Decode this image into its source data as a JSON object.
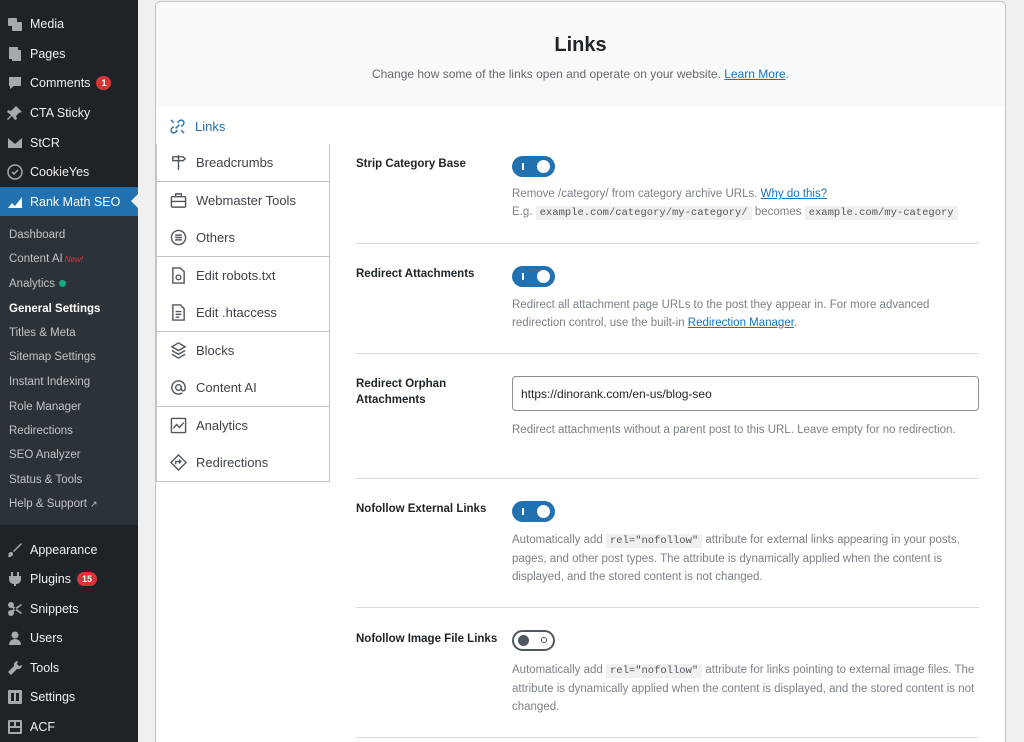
{
  "sidebar": {
    "top_items": [
      {
        "label": "Media",
        "icon": "media-icon"
      },
      {
        "label": "Pages",
        "icon": "pages-icon"
      },
      {
        "label": "Comments",
        "icon": "comments-icon",
        "badge": "1"
      },
      {
        "label": "CTA Sticky",
        "icon": "pin-icon"
      },
      {
        "label": "StCR",
        "icon": "envelope-icon"
      },
      {
        "label": "CookieYes",
        "icon": "cookie-icon"
      },
      {
        "label": "Rank Math SEO",
        "icon": "rank-math-icon"
      }
    ],
    "submenu": [
      {
        "label": "Dashboard"
      },
      {
        "label": "Content AI",
        "tag": "New!"
      },
      {
        "label": "Analytics"
      },
      {
        "label": "General Settings"
      },
      {
        "label": "Titles & Meta"
      },
      {
        "label": "Sitemap Settings"
      },
      {
        "label": "Instant Indexing"
      },
      {
        "label": "Role Manager"
      },
      {
        "label": "Redirections"
      },
      {
        "label": "SEO Analyzer"
      },
      {
        "label": "Status & Tools"
      },
      {
        "label": "Help & Support"
      }
    ],
    "bottom_items": [
      {
        "label": "Appearance",
        "icon": "brush-icon"
      },
      {
        "label": "Plugins",
        "icon": "plugin-icon",
        "badge": "15"
      },
      {
        "label": "Snippets",
        "icon": "snippets-icon"
      },
      {
        "label": "Users",
        "icon": "users-icon"
      },
      {
        "label": "Tools",
        "icon": "wrench-icon"
      },
      {
        "label": "Settings",
        "icon": "settings-icon"
      },
      {
        "label": "ACF",
        "icon": "acf-icon"
      }
    ]
  },
  "header": {
    "title": "Links",
    "description": "Change how some of the links open and operate on your website.",
    "learn_more": "Learn More",
    "period": "."
  },
  "tabs": [
    {
      "label": "Links",
      "icon": "links-icon",
      "active": true
    },
    {
      "label": "Breadcrumbs",
      "icon": "signpost-icon"
    },
    {
      "label": "Webmaster Tools",
      "icon": "toolbox-icon"
    },
    {
      "label": "Others",
      "icon": "list-circle-icon"
    },
    {
      "label": "Edit robots.txt",
      "icon": "file-robot-icon"
    },
    {
      "label": "Edit .htaccess",
      "icon": "file-text-icon"
    },
    {
      "label": "Blocks",
      "icon": "blocks-icon"
    },
    {
      "label": "Content AI",
      "icon": "at-icon"
    },
    {
      "label": "Analytics",
      "icon": "analytics-icon"
    },
    {
      "label": "Redirections",
      "icon": "redirect-icon"
    }
  ],
  "settings": {
    "strip_category": {
      "label": "Strip Category Base",
      "enabled": true,
      "desc_1": "Remove /category/ from category archive URLs.",
      "why_link": "Why do this?",
      "eg": "E.g.",
      "code_from": "example.com/category/my-category/",
      "becomes": "becomes",
      "code_to": "example.com/my-category"
    },
    "redirect_attachments": {
      "label": "Redirect Attachments",
      "enabled": true,
      "desc_1": "Redirect all attachment page URLs to the post they appear in. For more advanced redirection control, use the built-in",
      "link": "Redirection Manager",
      "period": "."
    },
    "redirect_orphan": {
      "label_line1": "Redirect Orphan",
      "label_line2": "Attachments",
      "value": "https://dinorank.com/en-us/blog-seo",
      "desc": "Redirect attachments without a parent post to this URL. Leave empty for no redirection."
    },
    "nofollow_external": {
      "label": "Nofollow External Links",
      "enabled": true,
      "desc_pre": "Automatically add",
      "code": "rel=\"nofollow\"",
      "desc_post": "attribute for external links appearing in your posts, pages, and other post types. The attribute is dynamically applied when the content is displayed, and the stored content is not changed."
    },
    "nofollow_image": {
      "label": "Nofollow Image File Links",
      "enabled": false,
      "desc_pre": "Automatically add",
      "code": "rel=\"nofollow\"",
      "desc_post": "attribute for links pointing to external image files. The attribute is dynamically applied when the content is displayed, and the stored content is not changed."
    }
  },
  "colors": {
    "sidebar_bg": "#1d2327",
    "submenu_bg": "#2c3338",
    "accent": "#2271b1",
    "badge": "#d63638",
    "analytics_dot": "#10ac84"
  }
}
